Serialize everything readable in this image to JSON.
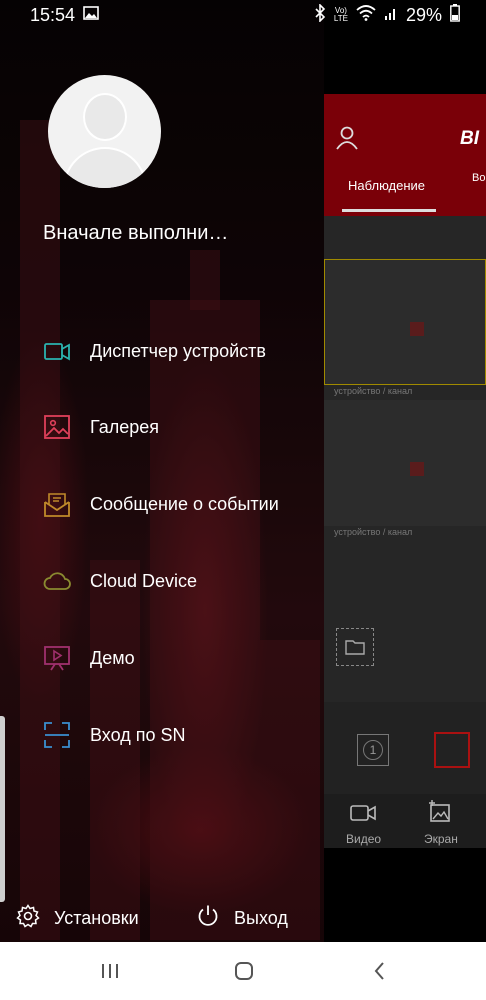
{
  "status_bar": {
    "time": "15:54",
    "volte_line1": "Vo)",
    "volte_line2": "LTE",
    "battery": "29%"
  },
  "background_app": {
    "brand": "BI",
    "tabs": [
      "Наблюдение",
      "Во"
    ],
    "pane_labels": [
      "устройство / канал",
      "устройство / канал"
    ],
    "num_button": "1",
    "nav": [
      {
        "label": "Видео",
        "icon": "video-camera-icon"
      },
      {
        "label": "Экран",
        "icon": "screenshot-icon"
      }
    ],
    "accent": "#7a0008"
  },
  "drawer": {
    "login_prompt": "Вначале выполни…",
    "menu": [
      {
        "label": "Диспетчер устройств",
        "icon": "video-camera-icon",
        "color": "#2bb3b0"
      },
      {
        "label": "Галерея",
        "icon": "image-icon",
        "color": "#e0405a"
      },
      {
        "label": "Сообщение о событии",
        "icon": "message-icon",
        "color": "#c08a2a"
      },
      {
        "label": "Cloud Device",
        "icon": "cloud-icon",
        "color": "#8a8a30"
      },
      {
        "label": "Демо",
        "icon": "presentation-icon",
        "color": "#a0306e"
      },
      {
        "label": "Вход по SN",
        "icon": "scan-icon",
        "color": "#3a8fd0"
      }
    ],
    "footer": {
      "settings_label": "Установки",
      "logout_label": "Выход"
    }
  },
  "system_nav": {
    "buttons": [
      "recent-apps-icon",
      "home-icon",
      "back-icon"
    ]
  }
}
